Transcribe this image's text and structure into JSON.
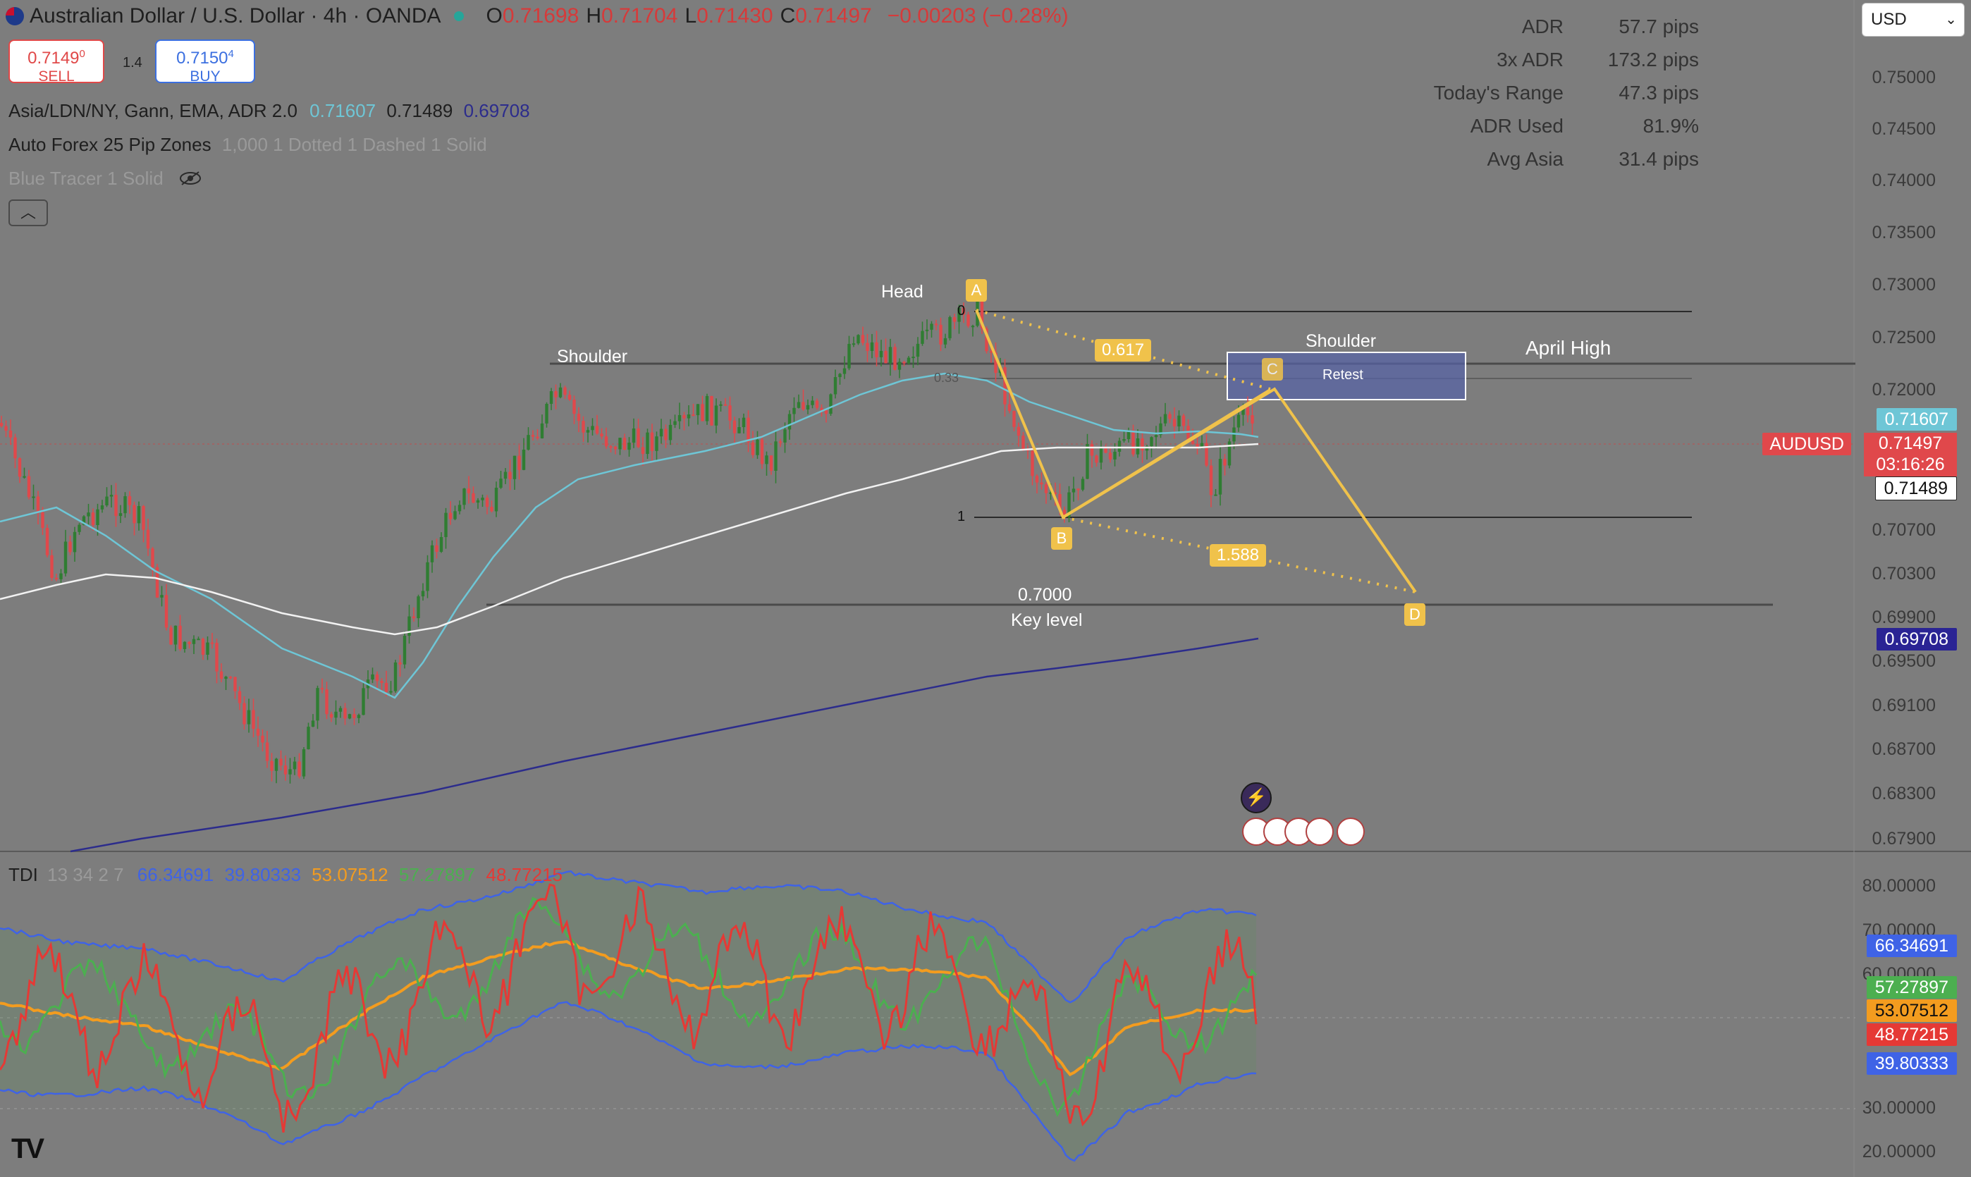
{
  "header": {
    "symbol_title": "Australian Dollar / U.S. Dollar · 4h · OANDA",
    "ohlc": [
      {
        "k": "O",
        "v": "0.71698"
      },
      {
        "k": "H",
        "v": "0.71704"
      },
      {
        "k": "L",
        "v": "0.71430"
      },
      {
        "k": "C",
        "v": "0.71497"
      },
      {
        "k": "",
        "v": "−0.00203 (−0.28%)"
      }
    ]
  },
  "trade": {
    "sell_price": "0.7149",
    "sell_sup": "0",
    "sell_label": "SELL",
    "spread": "1.4",
    "buy_price": "0.7150",
    "buy_sup": "4",
    "buy_label": "BUY"
  },
  "indicators": {
    "ind1_name": "Asia/LDN/NY, Gann, EMA, ADR 2.0",
    "ind1_v1": "0.71607",
    "ind1_v2": "0.71489",
    "ind1_v3": "0.69708",
    "ind2_name": "Auto Forex 25 Pip Zones",
    "ind2_params": "1,000 1 Dotted 1 Dashed 1 Solid",
    "ind3_name": "Blue Tracer 1 Solid",
    "eye_icon": "eye-off-icon",
    "collapse_icon": "chevron-up-icon"
  },
  "adr_table": [
    {
      "k": "ADR",
      "v": "57.7 pips"
    },
    {
      "k": "3x ADR",
      "v": "173.2 pips"
    },
    {
      "k": "Today's Range",
      "v": "47.3 pips"
    },
    {
      "k": "ADR Used",
      "v": "81.9%"
    },
    {
      "k": "Avg Asia",
      "v": "31.4 pips"
    }
  ],
  "currency_select": {
    "value": "USD",
    "icon": "chevron-down-icon"
  },
  "price_axis": [
    "0.75000",
    "0.74500",
    "0.74000",
    "0.73500",
    "0.73000",
    "0.72500",
    "0.72000",
    "0.70700",
    "0.70300",
    "0.69900",
    "0.69500",
    "0.69100",
    "0.68700",
    "0.68300",
    "0.67900"
  ],
  "price_tags": {
    "ema_fast": "0.71607",
    "symbol": "AUDUSD",
    "last": "0.71497",
    "countdown": "03:16:26",
    "mid": "0.71489",
    "ema_slow": "0.69708"
  },
  "annotations": {
    "head": "Head",
    "shoulder_left": "Shoulder",
    "shoulder_right": "Shoulder",
    "april_high": "April High",
    "retest": "Retest",
    "key_price": "0.7000",
    "key_level": "Key level",
    "fib_0": "0",
    "fib_033": "0.33",
    "fib_1": "1",
    "fib_0617": "0.617",
    "fib_1588": "1.588",
    "point_a": "A",
    "point_b": "B",
    "point_c": "C",
    "point_d": "D"
  },
  "tdi": {
    "name": "TDI",
    "params": "13 34 2 7",
    "v1": "66.34691",
    "v2": "39.80333",
    "v3": "53.07512",
    "v4": "57.27897",
    "v5": "48.77215",
    "axis": [
      "80.00000",
      "70.00000",
      "60.00000",
      "30.00000",
      "20.00000"
    ],
    "tags": {
      "upper": "66.34691",
      "green": "57.27897",
      "orange": "53.07512",
      "red": "48.77215",
      "lower": "39.80333"
    }
  },
  "colors": {
    "background": "#7d7d7d",
    "up_candle": "#2f7d32",
    "down_candle": "#e0484b",
    "ema_fast": "#6ec6d6",
    "ema_white": "#f2f2f2",
    "ema_slow": "#2c2c8c",
    "pattern": "#f0c24b",
    "tdi_blue": "#3f63e6",
    "tdi_green": "#4caf50",
    "tdi_orange": "#f39c1f",
    "tdi_red": "#e53935"
  },
  "branding": {
    "logo": "TV"
  }
}
